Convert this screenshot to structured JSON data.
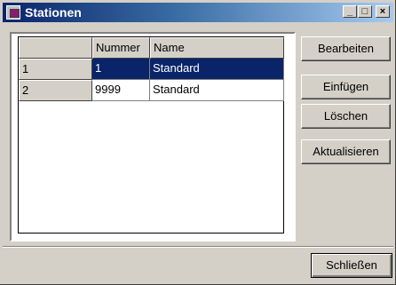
{
  "window": {
    "title": "Stationen",
    "controls": {
      "minimize": "_",
      "maximize": "□",
      "close": "×"
    }
  },
  "table": {
    "columns": [
      "",
      "Nummer",
      "Name"
    ],
    "rows": [
      {
        "index": "1",
        "nummer": "1",
        "name": "Standard",
        "selected": true
      },
      {
        "index": "2",
        "nummer": "9999",
        "name": "Standard",
        "selected": false
      }
    ]
  },
  "buttons": {
    "edit": "Bearbeiten",
    "insert": "Einfügen",
    "delete": "Löschen",
    "refresh": "Aktualisieren",
    "close": "Schließen"
  },
  "colors": {
    "selection": "#0a246a",
    "face": "#d4d0c8"
  }
}
